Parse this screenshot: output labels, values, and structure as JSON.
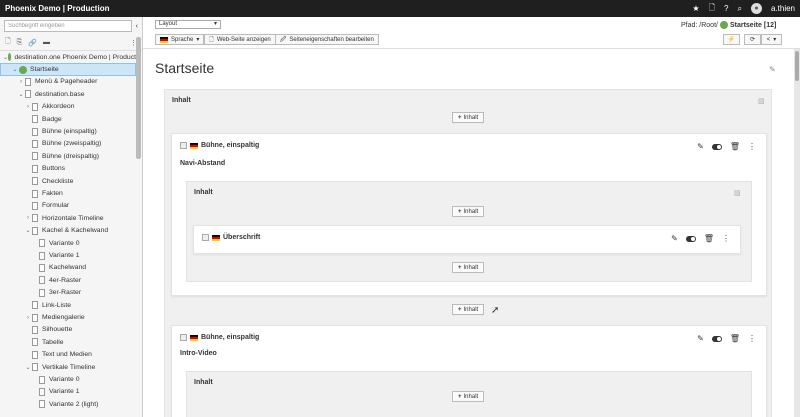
{
  "topbar": {
    "title": "Phoenix Demo | Production",
    "user": "a.thien",
    "icons": [
      "star-icon",
      "document-icon",
      "help-icon",
      "search-icon",
      "user-avatar-icon"
    ]
  },
  "tree": {
    "search_placeholder": "Suchbegriff eingeben",
    "nodes": [
      {
        "label": "destination.one Phoenix Demo | Product",
        "depth": 0,
        "expanded": true,
        "kind": "root"
      },
      {
        "label": "Startseite",
        "depth": 1,
        "expanded": true,
        "kind": "globe",
        "selected": true
      },
      {
        "label": "Menü & Pageheader",
        "depth": 2,
        "expanded": false,
        "kind": "page",
        "has_children": true
      },
      {
        "label": "destination.base",
        "depth": 2,
        "expanded": true,
        "kind": "page",
        "has_children": true
      },
      {
        "label": "Akkordeon",
        "depth": 3,
        "kind": "page",
        "has_children": true
      },
      {
        "label": "Badge",
        "depth": 3,
        "kind": "page"
      },
      {
        "label": "Bühne (einspaltig)",
        "depth": 3,
        "kind": "page"
      },
      {
        "label": "Bühne (zweispaltig)",
        "depth": 3,
        "kind": "page"
      },
      {
        "label": "Bühne (dreispaltig)",
        "depth": 3,
        "kind": "page"
      },
      {
        "label": "Buttons",
        "depth": 3,
        "kind": "page"
      },
      {
        "label": "Checkliste",
        "depth": 3,
        "kind": "page"
      },
      {
        "label": "Fakten",
        "depth": 3,
        "kind": "page"
      },
      {
        "label": "Formular",
        "depth": 3,
        "kind": "page"
      },
      {
        "label": "Horizontale Timeline",
        "depth": 3,
        "kind": "page",
        "has_children": true
      },
      {
        "label": "Kachel & Kachelwand",
        "depth": 3,
        "kind": "page",
        "expanded": true,
        "has_children": true
      },
      {
        "label": "Variante 0",
        "depth": 4,
        "kind": "page"
      },
      {
        "label": "Variante 1",
        "depth": 4,
        "kind": "page"
      },
      {
        "label": "Kachelwand",
        "depth": 4,
        "kind": "page"
      },
      {
        "label": "4er-Raster",
        "depth": 4,
        "kind": "page"
      },
      {
        "label": "3er-Raster",
        "depth": 4,
        "kind": "page"
      },
      {
        "label": "Link-Liste",
        "depth": 3,
        "kind": "page"
      },
      {
        "label": "Mediengalerie",
        "depth": 3,
        "kind": "page",
        "has_children": true
      },
      {
        "label": "Silhouette",
        "depth": 3,
        "kind": "page"
      },
      {
        "label": "Tabelle",
        "depth": 3,
        "kind": "page"
      },
      {
        "label": "Text und Medien",
        "depth": 3,
        "kind": "page"
      },
      {
        "label": "Vertikale Timeline",
        "depth": 3,
        "kind": "page",
        "expanded": true,
        "has_children": true
      },
      {
        "label": "Variante 0",
        "depth": 4,
        "kind": "page"
      },
      {
        "label": "Variante 1",
        "depth": 4,
        "kind": "page"
      },
      {
        "label": "Variante 2 (light)",
        "depth": 4,
        "kind": "page"
      }
    ]
  },
  "doc": {
    "layout_value": "Layout",
    "language_label": "Sprache",
    "view_button": "Web-Seite anzeigen",
    "properties_button": "Seiteneigenschaften bearbeiten",
    "path_label": "Pfad: /Root/",
    "page_name": "Startseite",
    "page_id": "[12]",
    "page_title": "Startseite"
  },
  "content": {
    "column_title": "Inhalt",
    "add_label": "Inhalt",
    "element1_title": "Bühne, einspaltig",
    "element1_sub": "Navi-Abstand",
    "nested_column_title": "Inhalt",
    "nested_element_title": "Überschrift",
    "element2_title": "Bühne, einspaltig",
    "element2_sub": "Intro-Video",
    "nested_column2_title": "Inhalt"
  },
  "colors": {
    "topbar": "#1f1f1f",
    "selected_node": "#cde6f7",
    "globe": "#6aa84f"
  }
}
